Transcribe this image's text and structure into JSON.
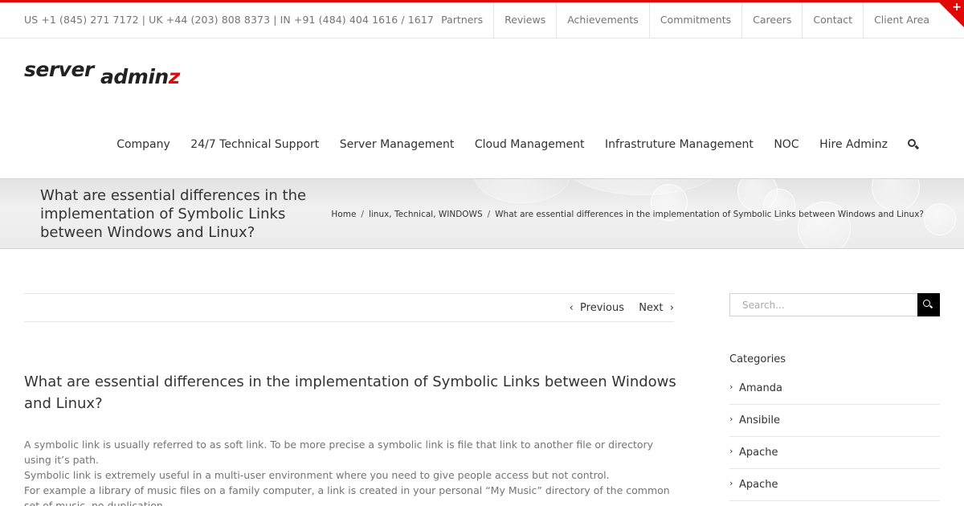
{
  "topbar": {
    "phones": "US +1 (845) 271 7172 | UK +44 (203) 808 8373 | IN +91 (484) 404 1616 / 1617",
    "links": [
      "Partners",
      "Reviews",
      "Achievements",
      "Commitments",
      "Careers",
      "Contact",
      "Client Area"
    ],
    "corner_symbol": "+"
  },
  "logo": {
    "word1": "server",
    "word2": "admin",
    "word2_accent": "z"
  },
  "mainnav": {
    "items": [
      "Company",
      "24/7 Technical Support",
      "Server Management",
      "Cloud Management",
      "Infrastruture Management",
      "NOC",
      "Hire Adminz"
    ],
    "search_icon": "search-icon"
  },
  "page_title": "What are essential differences in the implementation of Symbolic Links between Windows and Linux?",
  "breadcrumb": {
    "home": "Home",
    "categories": "linux, Technical, WINDOWS",
    "current": "What are essential differences in the implementation of Symbolic Links between Windows and Linux?",
    "separator": "/"
  },
  "post_nav": {
    "previous": "Previous",
    "next": "Next"
  },
  "post": {
    "title": "What are essential differences in the implementation of Symbolic Links between Windows and Linux?",
    "paragraphs": [
      "A symbolic link is usually referred to as soft link. To be more precise a symbolic link is file that link to another file or directory using it’s path.",
      "Symbolic link is extremely useful in a multi-user environment where you need to give people access but not control.",
      "For example a library of music files on a family computer, a link is created in your personal “My Music” directory of the common set of music, no duplication."
    ]
  },
  "sidebar": {
    "search_placeholder": "Search...",
    "categories_heading": "Categories",
    "categories": [
      "Amanda",
      "Ansibile",
      "Apache",
      "Apache"
    ]
  },
  "colors": {
    "accent": "#e10707",
    "text": "#333333",
    "muted": "#747474"
  }
}
